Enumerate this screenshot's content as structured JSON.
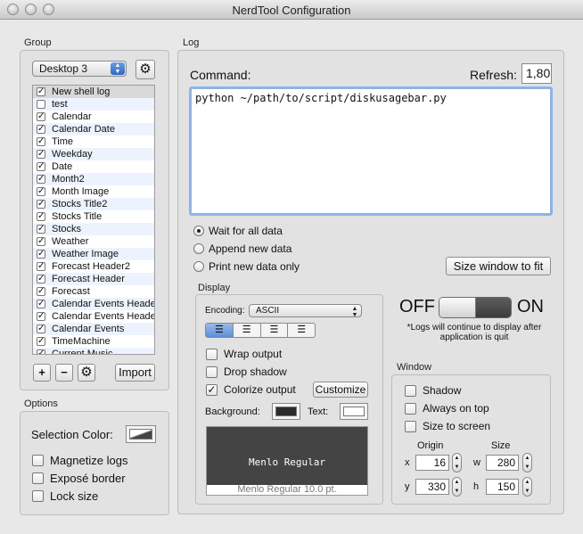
{
  "window": {
    "title": "NerdTool Configuration"
  },
  "group": {
    "section_label": "Group",
    "popup_value": "Desktop 3",
    "items": [
      {
        "label": "New shell log",
        "checked": true
      },
      {
        "label": "test",
        "checked": false
      },
      {
        "label": "Calendar",
        "checked": true
      },
      {
        "label": "Calendar Date",
        "checked": true
      },
      {
        "label": "Time",
        "checked": true
      },
      {
        "label": "Weekday",
        "checked": true
      },
      {
        "label": "Date",
        "checked": true
      },
      {
        "label": "Month2",
        "checked": true
      },
      {
        "label": "Month Image",
        "checked": true
      },
      {
        "label": "Stocks Title2",
        "checked": true
      },
      {
        "label": "Stocks Title",
        "checked": true
      },
      {
        "label": "Stocks",
        "checked": true
      },
      {
        "label": "Weather",
        "checked": true
      },
      {
        "label": "Weather Image",
        "checked": true
      },
      {
        "label": "Forecast Header2",
        "checked": true
      },
      {
        "label": "Forecast Header",
        "checked": true
      },
      {
        "label": "Forecast",
        "checked": true
      },
      {
        "label": "Calendar Events Header",
        "checked": true
      },
      {
        "label": "Calendar Events Header",
        "checked": true
      },
      {
        "label": "Calendar Events",
        "checked": true
      },
      {
        "label": "TimeMachine",
        "checked": true
      },
      {
        "label": "Current Music",
        "checked": true
      }
    ],
    "add_label": "+",
    "remove_label": "−",
    "import_label": "Import"
  },
  "options": {
    "section_label": "Options",
    "selection_color_label": "Selection Color:",
    "magnetize_label": "Magnetize logs",
    "expose_label": "Exposé border",
    "lock_label": "Lock size"
  },
  "log": {
    "section_label": "Log",
    "command_label": "Command:",
    "refresh_label": "Refresh:",
    "refresh_value": "1,80",
    "command_value": "python ~/path/to/script/diskusagebar.py",
    "radio_wait": "Wait for all data",
    "radio_append": "Append new data",
    "radio_print": "Print new data only",
    "size_window_label": "Size window to fit"
  },
  "display": {
    "section_label": "Display",
    "encoding_label": "Encoding:",
    "encoding_value": "ASCII",
    "wrap_label": "Wrap output",
    "shadow_label": "Drop shadow",
    "colorize_label": "Colorize output",
    "customize_label": "Customize",
    "background_label": "Background:",
    "text_label": "Text:",
    "font_preview": "Menlo Regular",
    "font_caption": "Menlo Regular 10.0 pt."
  },
  "toggle": {
    "off_label": "OFF",
    "on_label": "ON",
    "note": "*Logs will continue to display after application is quit"
  },
  "window_box": {
    "section_label": "Window",
    "shadow_label": "Shadow",
    "always_on_top_label": "Always on top",
    "size_to_screen_label": "Size to screen",
    "origin_label": "Origin",
    "size_label": "Size",
    "x_label": "x",
    "y_label": "y",
    "w_label": "w",
    "h_label": "h",
    "x_value": "16",
    "y_value": "330",
    "w_value": "280",
    "h_value": "150"
  },
  "colors": {
    "accent": "#5b8dd6",
    "focus_ring": "#8fb3e6"
  }
}
